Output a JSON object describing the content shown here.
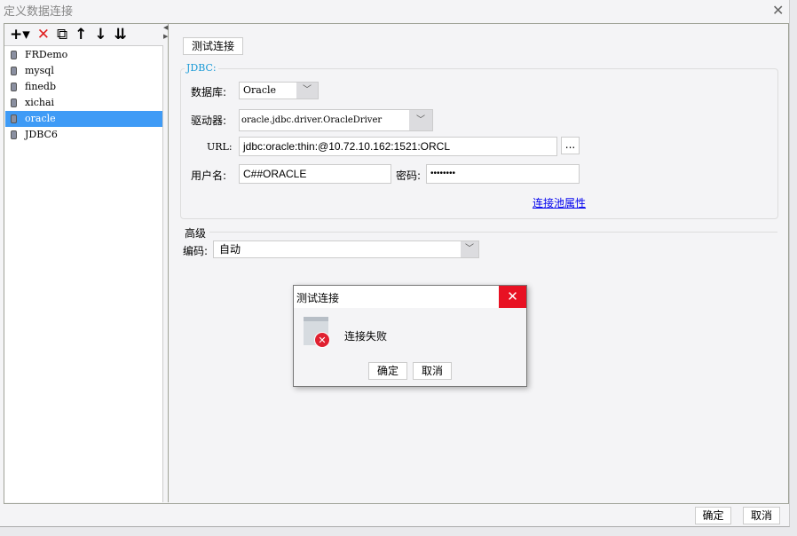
{
  "window": {
    "title": "定义数据连接",
    "close_icon": "close-icon"
  },
  "toolbar": {
    "add": "+▾",
    "delete": "✕",
    "copy": "⧉",
    "up": "↑",
    "down": "↓",
    "sort": "⇊"
  },
  "connections": [
    {
      "name": "FRDemo"
    },
    {
      "name": "mysql"
    },
    {
      "name": "finedb"
    },
    {
      "name": "xichai"
    },
    {
      "name": "oracle",
      "selected": true
    },
    {
      "name": "JDBC6"
    }
  ],
  "main": {
    "test_button": "测试连接",
    "group_label": "JDBC:",
    "database_label": "数据库:",
    "database_value": "Oracle",
    "driver_label": "驱动器:",
    "driver_value": "oracle.jdbc.driver.OracleDriver",
    "url_label": "URL:",
    "url_value": "jdbc:oracle:thin:@10.72.10.162:1521:ORCL",
    "url_more": "...",
    "user_label": "用户名:",
    "user_value": "C##ORACLE",
    "password_label": "密码:",
    "password_value": "••••••••",
    "pool_link": "连接池属性",
    "advanced_label": "高级",
    "encoding_label": "编码:",
    "encoding_value": "自动"
  },
  "dialog": {
    "title": "测试连接",
    "message": "连接失败",
    "ok": "确定",
    "cancel": "取消",
    "accent": "#e81123"
  },
  "footer": {
    "ok": "确定",
    "cancel": "取消"
  }
}
